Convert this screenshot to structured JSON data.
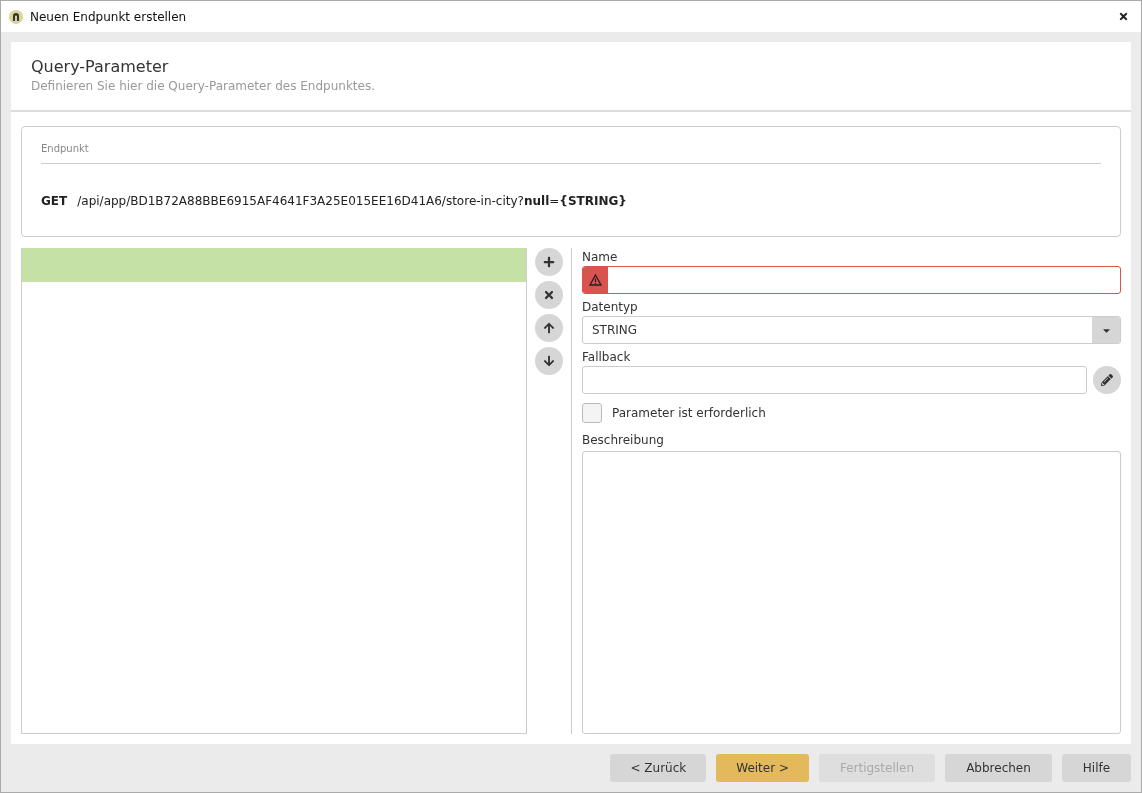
{
  "window": {
    "title": "Neuen Endpunkt erstellen"
  },
  "header": {
    "title": "Query-Parameter",
    "subtitle": "Definieren Sie hier die Query-Parameter des Endpunktes."
  },
  "endpoint": {
    "label": "Endpunkt",
    "method": "GET",
    "url": "/api/app/BD1B72A88BBE6915AF4641F3A25E015EE16D41A6/store-in-city?**null**=**{STRING}**"
  },
  "parameters": [
    {
      "selected": true
    }
  ],
  "list_actions": [
    {
      "kind": "add"
    },
    {
      "kind": "remove"
    },
    {
      "kind": "up"
    },
    {
      "kind": "down"
    }
  ],
  "form": {
    "name": {
      "label": "Name",
      "error": true
    },
    "datatype": {
      "label": "Datentyp",
      "value": "STRING"
    },
    "fallback": {
      "label": "Fallback"
    },
    "required": {
      "label": "Parameter ist erforderlich",
      "checked": false
    },
    "description": {
      "label": "Beschreibung"
    }
  },
  "buttons": [
    {
      "label": "< Zurück",
      "kind": "normal"
    },
    {
      "label": "Weiter >",
      "kind": "primary"
    },
    {
      "label": "Fertigstellen",
      "kind": "disabled"
    },
    {
      "label": "Abbrechen",
      "kind": "normal"
    },
    {
      "label": "Hilfe",
      "kind": "normal"
    }
  ]
}
